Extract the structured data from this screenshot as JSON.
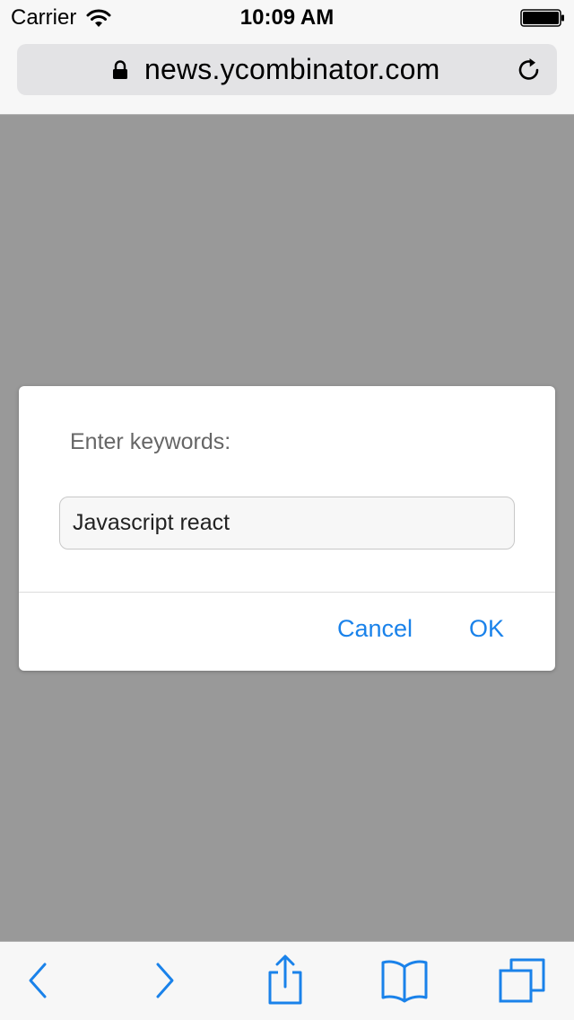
{
  "status_bar": {
    "carrier": "Carrier",
    "time": "10:09 AM",
    "icons": [
      "wifi-icon",
      "battery-icon"
    ]
  },
  "browser": {
    "url": "news.ycombinator.com",
    "icons": [
      "lock-icon",
      "reload-icon"
    ]
  },
  "dialog": {
    "label": "Enter keywords:",
    "input_value": "Javascript react",
    "cancel_label": "Cancel",
    "ok_label": "OK"
  },
  "toolbar": {
    "icons": [
      "back-icon",
      "forward-icon",
      "share-icon",
      "bookmarks-icon",
      "tabs-icon"
    ]
  },
  "colors": {
    "accent": "#1a82ea",
    "overlay": "#999999",
    "chrome": "#f7f7f7"
  }
}
